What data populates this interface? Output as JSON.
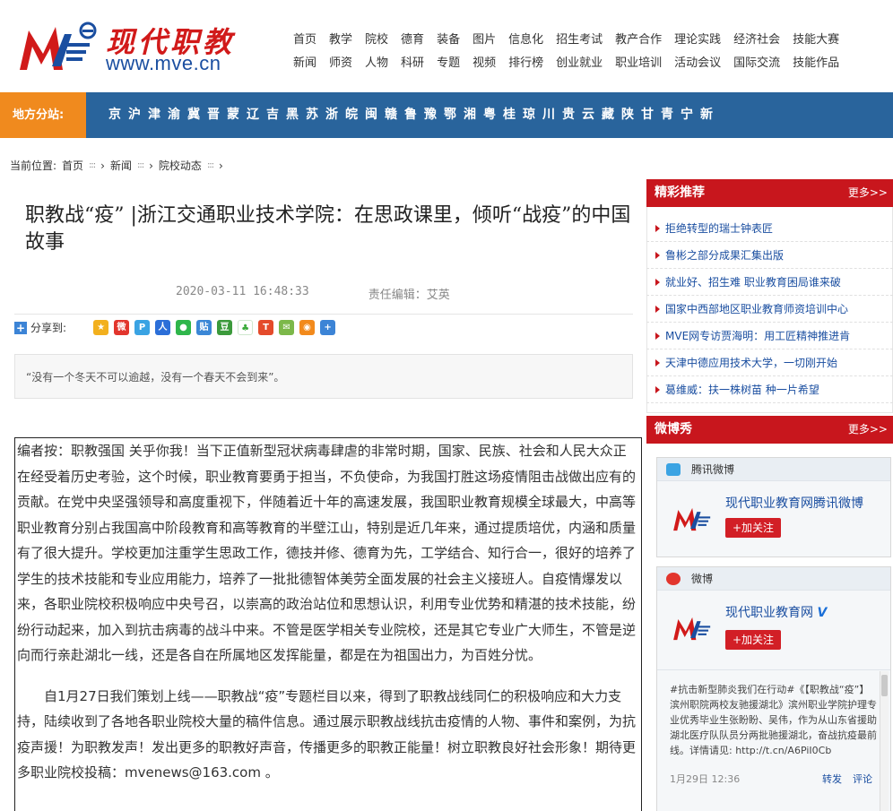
{
  "header": {
    "logo_cn": "现代职教",
    "logo_url": "www.mve.cn",
    "nav_row1": [
      "首页",
      "教学",
      "院校",
      "德育",
      "装备",
      "图片",
      "信息化",
      "招生考试",
      "教产合作",
      "理论实践",
      "经济社会",
      "技能大赛"
    ],
    "nav_row2": [
      "新闻",
      "师资",
      "人物",
      "科研",
      "专题",
      "视频",
      "排行榜",
      "创业就业",
      "职业培训",
      "活动会议",
      "国际交流",
      "技能作品"
    ]
  },
  "region": {
    "label": "地方分站:",
    "items": [
      "京",
      "沪",
      "津",
      "渝",
      "冀",
      "晋",
      "蒙",
      "辽",
      "吉",
      "黑",
      "苏",
      "浙",
      "皖",
      "闽",
      "赣",
      "鲁",
      "豫",
      "鄂",
      "湘",
      "粤",
      "桂",
      "琼",
      "川",
      "贵",
      "云",
      "藏",
      "陕",
      "甘",
      "青",
      "宁",
      "新"
    ]
  },
  "breadcrumb": {
    "prefix": "当前位置:",
    "items": [
      "首页",
      "新闻",
      "院校动态"
    ],
    "sep": ":::"
  },
  "article": {
    "title": "职教战“疫” |浙江交通职业技术学院：在思政课里，倾听“战疫”的中国故事",
    "date": "2020-03-11 16:48:33",
    "editor": "责任编辑：艾英",
    "share_label": "分享到:",
    "quote": "“没有一个冬天不可以逾越，没有一个春天不会到来”。",
    "para1": "编者按：职教强国 关乎你我！当下正值新型冠状病毒肆虐的非常时期，国家、民族、社会和人民大众正在经受着历史考验，这个时候，职业教育要勇于担当，不负使命，为我国打胜这场疫情阻击战做出应有的贡献。在党中央坚强领导和高度重视下，伴随着近十年的高速发展，我国职业教育规模全球最大，中高等职业教育分别占我国高中阶段教育和高等教育的半壁江山，特别是近几年来，通过提质培优，内涵和质量有了很大提升。学校更加注重学生思政工作，德技并修、德育为先，工学结合、知行合一，很好的培养了学生的技术技能和专业应用能力，培养了一批批德智体美劳全面发展的社会主义接班人。自疫情爆发以来，各职业院校积极响应中央号召，以崇高的政治站位和思想认识，利用专业优势和精湛的技术技能，纷纷行动起来，加入到抗击病毒的战斗中来。不管是医学相关专业院校，还是其它专业广大师生，不管是逆向而行亲赴湖北一线，还是各自在所属地区发挥能量，都是在为祖国出力，为百姓分忧。",
    "para2": "自1月27日我们策划上线——职教战“疫”专题栏目以来，得到了职教战线同仁的积极响应和大力支持，陆续收到了各地各职业院校大量的稿件信息。通过展示职教战线抗击疫情的人物、事件和案例，为抗疫声援！为职教发声！发出更多的职教好声音，传播更多的职教正能量！树立职教良好社会形象！期待更多职业院校投稿：mvenews@163.com 。"
  },
  "sidebar": {
    "rec_title": "精彩推荐",
    "more": "更多>>",
    "rec_items": [
      "拒绝转型的瑞士钟表匠",
      "鲁彬之部分成果汇集出版",
      "就业好、招生难 职业教育困局谁来破",
      "国家中西部地区职业教育师资培训中心",
      "MVE网专访贾海明：用工匠精神推进肯",
      "天津中德应用技术大学，一切刚开始",
      "葛维威：扶一株树苗 种一片希望"
    ],
    "weibo_title": "微博秀",
    "tencent": {
      "label": "腾讯微博",
      "name": "现代职业教育网腾讯微博",
      "follow": "+加关注"
    },
    "sina": {
      "label": "微博",
      "name": "现代职业教育网",
      "follow": "+加关注",
      "post": "#抗击新型肺炎我们在行动#《【职教战“疫”】滨州职院两校友驰援湖北》滨州职业学院护理专业优秀毕业生张盼盼、吴伟，作为从山东省援助湖北医疗队队员分两批驰援湖北，奋战抗疫最前线。详情请见: http://t.cn/A6PiI0Cb",
      "time": "1月29日 12:36",
      "repost": "转发",
      "comment": "评论"
    }
  },
  "colors": {
    "brand_red": "#c8161d",
    "nav_blue": "#29649c",
    "accent_orange": "#f08a1e",
    "link_blue": "#1a4ea0"
  }
}
